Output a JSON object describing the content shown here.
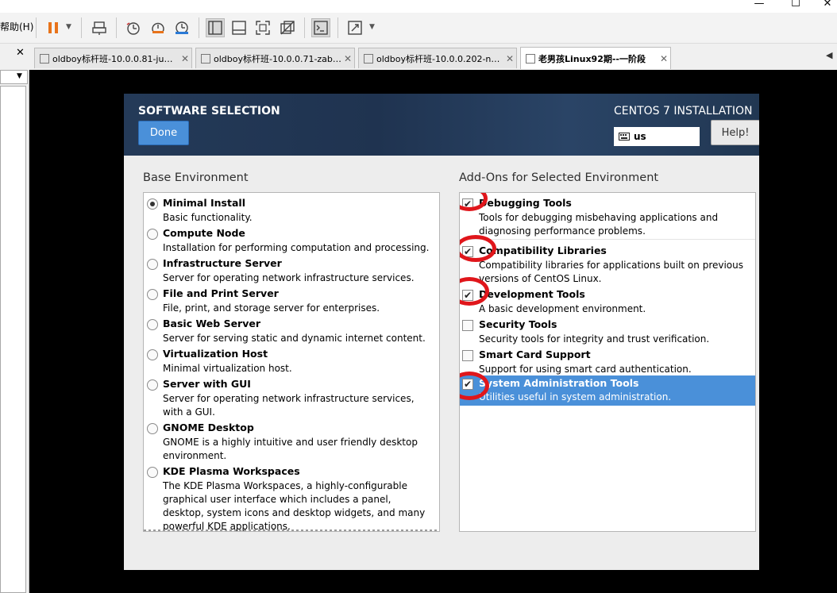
{
  "window": {
    "menu_help": "帮助(H)",
    "controls": [
      "—",
      "☐",
      "✕"
    ]
  },
  "left_pane": {
    "close_glyph": "✕",
    "dropdown_glyph": "▼"
  },
  "tabs": [
    {
      "label": "oldboy标杆班-10.0.0.81-jum...",
      "active": false,
      "close": "✕"
    },
    {
      "label": "oldboy标杆班-10.0.0.71-zabbix",
      "active": false,
      "close": "✕"
    },
    {
      "label": "oldboy标杆班-10.0.0.202-ne...",
      "active": false,
      "close": "✕"
    },
    {
      "label": "老男孩Linux92期--一阶段",
      "active": true,
      "close": "✕"
    }
  ],
  "tab_nav": "◀",
  "installer": {
    "title": "SOFTWARE SELECTION",
    "done_label": "Done",
    "product": "CENTOS 7 INSTALLATION",
    "keyboard_layout": "us",
    "help_label": "Help!",
    "base_heading": "Base Environment",
    "addon_heading": "Add-Ons for Selected Environment",
    "environments": [
      {
        "name": "Minimal Install",
        "desc": "Basic functionality.",
        "selected": true
      },
      {
        "name": "Compute Node",
        "desc": "Installation for performing computation and processing.",
        "selected": false
      },
      {
        "name": "Infrastructure Server",
        "desc": "Server for operating network infrastructure services.",
        "selected": false
      },
      {
        "name": "File and Print Server",
        "desc": "File, print, and storage server for enterprises.",
        "selected": false
      },
      {
        "name": "Basic Web Server",
        "desc": "Server for serving static and dynamic internet content.",
        "selected": false
      },
      {
        "name": "Virtualization Host",
        "desc": "Minimal virtualization host.",
        "selected": false
      },
      {
        "name": "Server with GUI",
        "desc": "Server for operating network infrastructure services, with a GUI.",
        "selected": false
      },
      {
        "name": "GNOME Desktop",
        "desc": "GNOME is a highly intuitive and user friendly desktop environment.",
        "selected": false
      },
      {
        "name": "KDE Plasma Workspaces",
        "desc": "The KDE Plasma Workspaces, a highly-configurable graphical user interface which includes a panel, desktop, system icons and desktop widgets, and many powerful KDE applications.",
        "selected": false
      }
    ],
    "addons": [
      {
        "name": "Debugging Tools",
        "desc": "Tools for debugging misbehaving applications and diagnosing performance problems.",
        "checked": true,
        "highlighted": false
      },
      {
        "name": "Compatibility Libraries",
        "desc": "Compatibility libraries for applications built on previous versions of CentOS Linux.",
        "checked": true,
        "highlighted": false
      },
      {
        "name": "Development Tools",
        "desc": "A basic development environment.",
        "checked": true,
        "highlighted": false
      },
      {
        "name": "Security Tools",
        "desc": "Security tools for integrity and trust verification.",
        "checked": false,
        "highlighted": false
      },
      {
        "name": "Smart Card Support",
        "desc": "Support for using smart card authentication.",
        "checked": false,
        "highlighted": false
      },
      {
        "name": "System Administration Tools",
        "desc": "Utilities useful in system administration.",
        "checked": true,
        "highlighted": true
      }
    ],
    "check_glyph": "✔"
  },
  "colors": {
    "header_bg": "#213752",
    "done_button": "#4a90d9",
    "selection": "#4a90d9",
    "annotation_ring": "#e0161b",
    "pause_icon": "#e8731a"
  }
}
